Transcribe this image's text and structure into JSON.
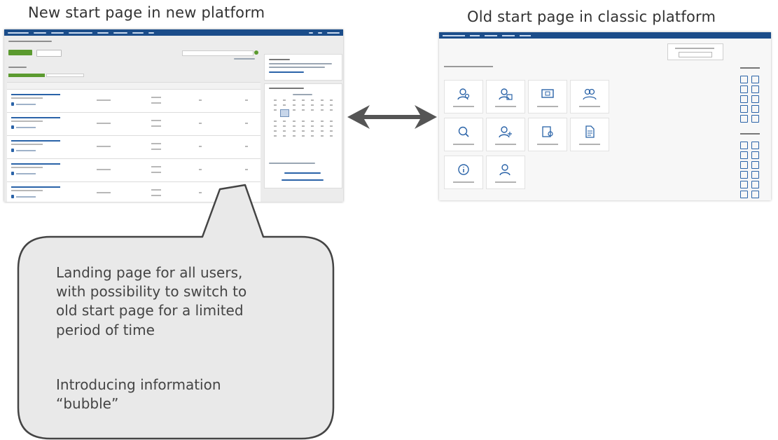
{
  "captions": {
    "new_page": "New start page in new platform",
    "old_page": "Old start page in classic platform"
  },
  "bubble": {
    "paragraph1": [
      "Landing page for all users,",
      "with possibility to switch to",
      "old start page for a limited",
      "period of time"
    ],
    "paragraph2": [
      "Introducing information",
      "“bubble”"
    ]
  },
  "colors": {
    "nav_bar": "#1b4d8a",
    "accent_green": "#5b9a2f",
    "link_blue": "#2a63a8",
    "bubble_fill": "#e9e9e9",
    "bubble_stroke": "#444444",
    "arrow": "#555555"
  },
  "icons": {
    "arrow": "double-headed-arrow",
    "old_tiles": [
      "user-search-icon",
      "users-icon",
      "screen-icon",
      "group-icon",
      "search-icon",
      "user-add-icon",
      "document-settings-icon",
      "document-icon",
      "info-icon",
      "user-icon"
    ]
  }
}
